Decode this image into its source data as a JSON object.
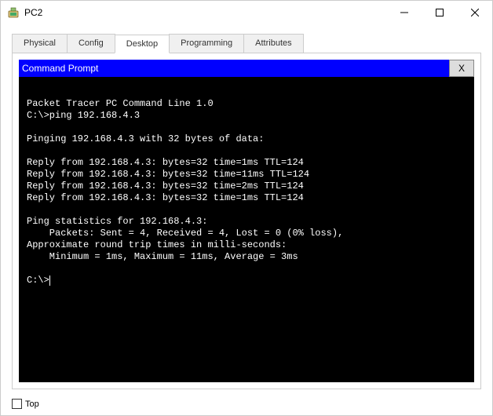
{
  "window": {
    "title": "PC2"
  },
  "tabs": {
    "items": [
      {
        "label": "Physical"
      },
      {
        "label": "Config"
      },
      {
        "label": "Desktop"
      },
      {
        "label": "Programming"
      },
      {
        "label": "Attributes"
      }
    ],
    "active_index": 2
  },
  "command_prompt": {
    "title": "Command Prompt",
    "close_label": "X"
  },
  "terminal": {
    "lines": [
      "",
      "Packet Tracer PC Command Line 1.0",
      "C:\\>ping 192.168.4.3",
      "",
      "Pinging 192.168.4.3 with 32 bytes of data:",
      "",
      "Reply from 192.168.4.3: bytes=32 time=1ms TTL=124",
      "Reply from 192.168.4.3: bytes=32 time=11ms TTL=124",
      "Reply from 192.168.4.3: bytes=32 time=2ms TTL=124",
      "Reply from 192.168.4.3: bytes=32 time=1ms TTL=124",
      "",
      "Ping statistics for 192.168.4.3:",
      "    Packets: Sent = 4, Received = 4, Lost = 0 (0% loss),",
      "Approximate round trip times in milli-seconds:",
      "    Minimum = 1ms, Maximum = 11ms, Average = 3ms",
      "",
      "C:\\>"
    ]
  },
  "bottom": {
    "top_label": "Top",
    "top_checked": false
  }
}
